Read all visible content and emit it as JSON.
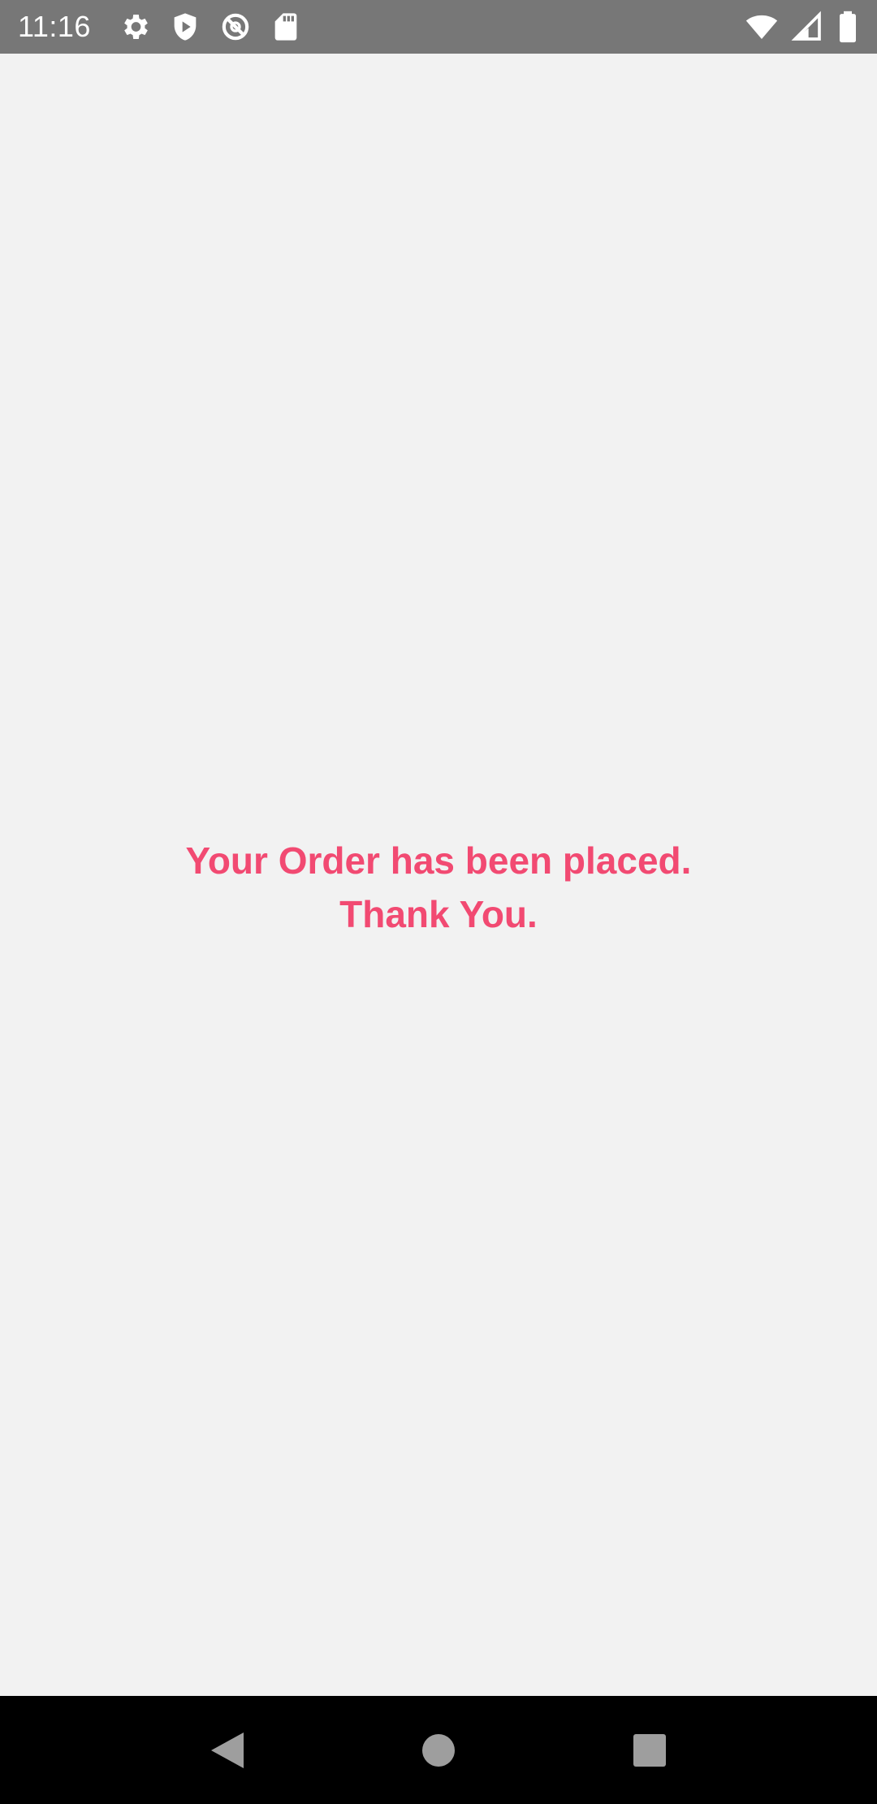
{
  "status_bar": {
    "time": "11:16",
    "left_icons": [
      "gear-icon",
      "shield-icon",
      "no-sync-icon",
      "sd-card-icon"
    ],
    "right_icons": [
      "wifi-icon",
      "cell-signal-icon",
      "battery-icon"
    ]
  },
  "main": {
    "message_line1": "Your Order has been placed.",
    "message_line2": "Thank You.",
    "message_color": "#f24a72"
  },
  "nav_bar": {
    "buttons": [
      "back-icon",
      "home-icon",
      "recents-icon"
    ]
  },
  "colors": {
    "status_bar_bg": "#777777",
    "background": "#f2f2f2",
    "nav_bar_bg": "#000000",
    "nav_icon": "#9e9e9e"
  }
}
